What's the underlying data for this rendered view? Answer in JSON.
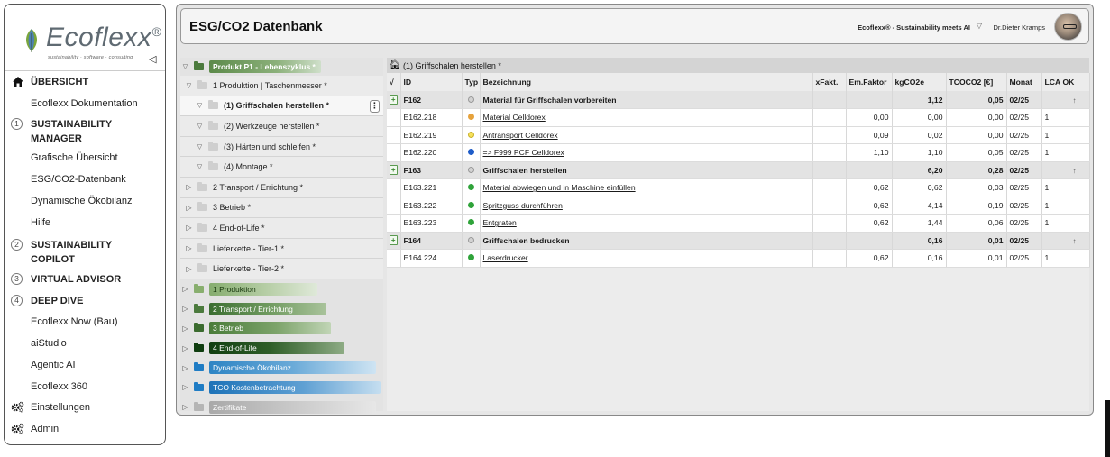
{
  "sidebar": {
    "logo": {
      "name": "Ecoflexx",
      "reg": "®",
      "tagline": "sustainability · software · consulting"
    },
    "items": [
      {
        "label": "ÜBERSICHT",
        "section": true,
        "icon": "home-icon"
      },
      {
        "label": "Ecoflexx Dokumentation"
      },
      {
        "label": "SUSTAINABILITY MANAGER",
        "section": true,
        "num": "1"
      },
      {
        "label": "Grafische Übersicht"
      },
      {
        "label": "ESG/CO2-Datenbank"
      },
      {
        "label": "Dynamische Ökobilanz"
      },
      {
        "label": "Hilfe"
      },
      {
        "label": "SUSTAINABILITY COPILOT",
        "section": true,
        "num": "2"
      },
      {
        "label": "VIRTUAL ADVISOR",
        "section": true,
        "num": "3"
      },
      {
        "label": "DEEP DIVE",
        "section": true,
        "num": "4"
      },
      {
        "label": "Ecoflexx Now (Bau)"
      },
      {
        "label": "aiStudio"
      },
      {
        "label": "Agentic AI"
      },
      {
        "label": "Ecoflexx 360"
      },
      {
        "label": "Einstellungen",
        "icon": "gears-icon"
      },
      {
        "label": "Admin",
        "icon": "gears-icon"
      }
    ]
  },
  "header": {
    "title": "ESG/CO2 Datenbank",
    "brand": "Ecoflexx® - Sustainability meets AI",
    "user": "Dr.Dieter Kramps"
  },
  "tree": {
    "root": "Produkt P1 - Lebenszyklus *",
    "sub": [
      {
        "label": "1 Produktion | Taschenmesser *",
        "indent": 1,
        "open": true
      },
      {
        "label": "(1) Griffschalen herstellen *",
        "indent": 2,
        "open": true,
        "active": true
      },
      {
        "label": "(2) Werkzeuge herstellen *",
        "indent": 2,
        "open": true
      },
      {
        "label": "(3) Härten und schleifen *",
        "indent": 2,
        "open": true
      },
      {
        "label": "(4) Montage *",
        "indent": 2,
        "open": true
      },
      {
        "label": "2 Transport / Errichtung *",
        "indent": 1
      },
      {
        "label": "3 Betrieb *",
        "indent": 1
      },
      {
        "label": "4 End-of-Life *",
        "indent": 1
      },
      {
        "label": "Lieferkette - Tier-1 *",
        "indent": 1
      },
      {
        "label": "Lieferkette - Tier-2 *",
        "indent": 1
      }
    ],
    "groups": [
      {
        "label": "1 Produktion",
        "pill": "pill-g1",
        "folder": "f-green2"
      },
      {
        "label": "2 Transport / Errichtung",
        "pill": "pill-g2",
        "folder": "f-green1"
      },
      {
        "label": "3 Betrieb",
        "pill": "pill-g3",
        "folder": "f-green3"
      },
      {
        "label": "4 End-of-Life",
        "pill": "pill-g4",
        "folder": "f-green4"
      },
      {
        "label": "Dynamische Ökobilanz",
        "pill": "pill-b1",
        "folder": "f-blue"
      },
      {
        "label": "TCO Kostenbetrachtung",
        "pill": "pill-b2",
        "folder": "f-blue"
      },
      {
        "label": "Zertifikate",
        "pill": "pill-gr",
        "folder": "f-gray"
      }
    ]
  },
  "table": {
    "path": "(1) Griffschalen herstellen *",
    "columns": [
      "√",
      "ID",
      "Typ",
      "Bezeichnung",
      "xFakt.",
      "Em.Faktor",
      "kgCO2e",
      "TCOCO2 [€]",
      "Monat",
      "LCA",
      "OK"
    ],
    "rows": [
      {
        "kind": "grp",
        "id": "F162",
        "typ": "gray",
        "name": "Material für Griffschalen vorbereiten",
        "xf": "",
        "em": "",
        "kg": "1,12",
        "tco": "0,05",
        "monat": "02/25",
        "lca": "",
        "ok": "↑"
      },
      {
        "kind": "itm",
        "id": "E162.218",
        "typ": "orange",
        "name": "Material Celldorex",
        "xf": "",
        "em": "0,00",
        "kg": "0,00",
        "tco": "0,00",
        "monat": "02/25",
        "lca": "1",
        "ok": ""
      },
      {
        "kind": "itm",
        "id": "E162.219",
        "typ": "yellow",
        "name": "Antransport Celldorex",
        "xf": "",
        "em": "0,09",
        "kg": "0,02",
        "tco": "0,00",
        "monat": "02/25",
        "lca": "1",
        "ok": ""
      },
      {
        "kind": "itm",
        "id": "E162.220",
        "typ": "blue",
        "name": "=> F999 PCF Celldorex",
        "xf": "",
        "em": "1,10",
        "kg": "1,10",
        "tco": "0,05",
        "monat": "02/25",
        "lca": "1",
        "ok": ""
      },
      {
        "kind": "grp",
        "id": "F163",
        "typ": "gray",
        "name": "Griffschalen herstellen",
        "xf": "",
        "em": "",
        "kg": "6,20",
        "tco": "0,28",
        "monat": "02/25",
        "lca": "",
        "ok": "↑"
      },
      {
        "kind": "itm",
        "id": "E163.221",
        "typ": "green",
        "name": "Material abwiegen und in Maschine einfüllen",
        "xf": "",
        "em": "0,62",
        "kg": "0,62",
        "tco": "0,03",
        "monat": "02/25",
        "lca": "1",
        "ok": ""
      },
      {
        "kind": "itm",
        "id": "E163.222",
        "typ": "green",
        "name": "Spritzguss durchführen",
        "xf": "",
        "em": "0,62",
        "kg": "4,14",
        "tco": "0,19",
        "monat": "02/25",
        "lca": "1",
        "ok": ""
      },
      {
        "kind": "itm",
        "id": "E163.223",
        "typ": "green",
        "name": "Entgraten",
        "xf": "",
        "em": "0,62",
        "kg": "1,44",
        "tco": "0,06",
        "monat": "02/25",
        "lca": "1",
        "ok": ""
      },
      {
        "kind": "grp",
        "id": "F164",
        "typ": "gray",
        "name": "Griffschalen bedrucken",
        "xf": "",
        "em": "",
        "kg": "0,16",
        "tco": "0,01",
        "monat": "02/25",
        "lca": "",
        "ok": "↑"
      },
      {
        "kind": "itm",
        "id": "E164.224",
        "typ": "green",
        "name": "Laserdrucker",
        "xf": "",
        "em": "0,62",
        "kg": "0,16",
        "tco": "0,01",
        "monat": "02/25",
        "lca": "1",
        "ok": ""
      }
    ]
  }
}
